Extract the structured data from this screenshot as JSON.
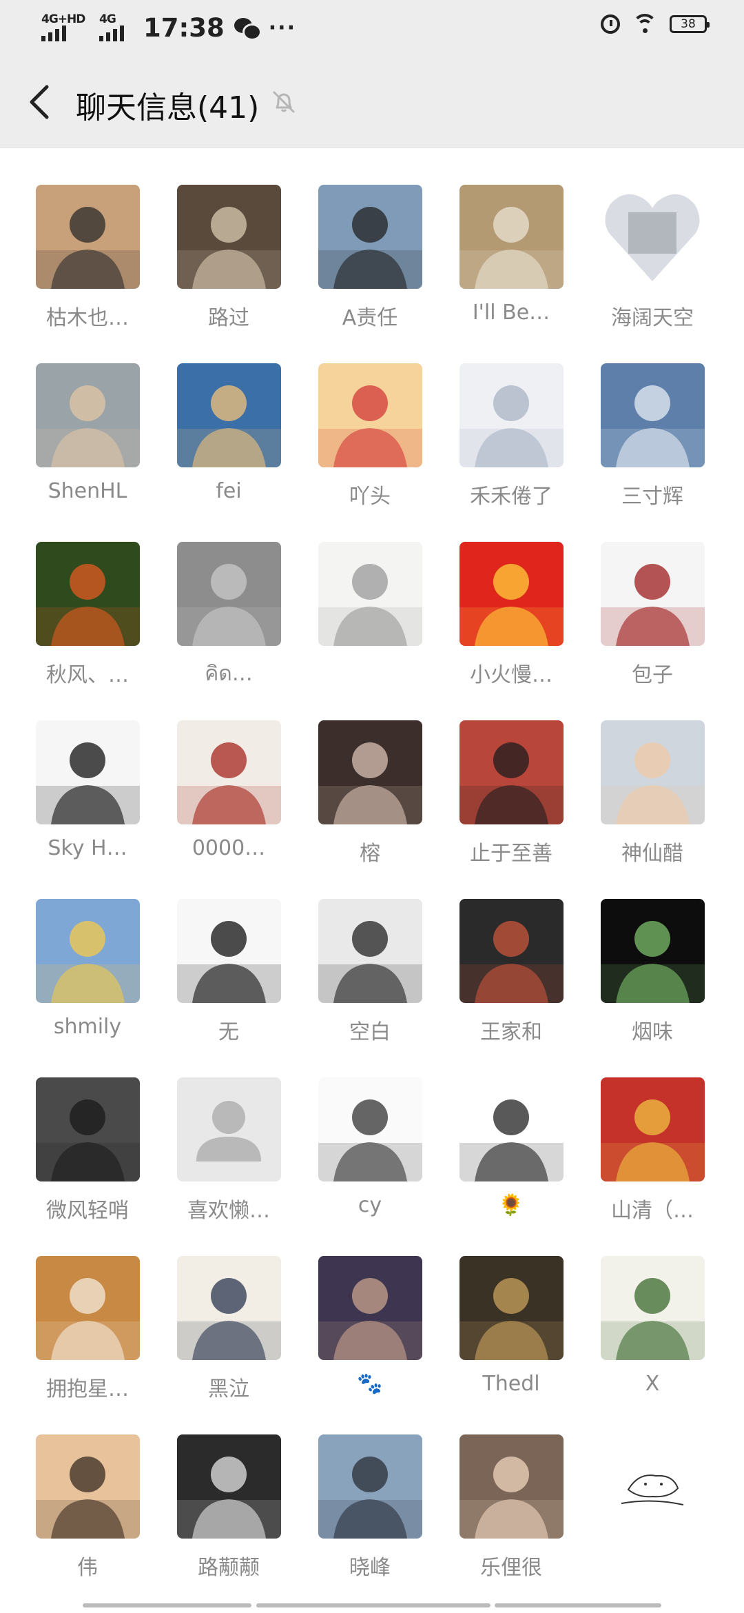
{
  "status_bar": {
    "signal1": "4G+HD",
    "signal2": "4G",
    "time": "17:38",
    "more": "···",
    "battery": "38"
  },
  "header": {
    "title": "聊天信息(41)",
    "icons": [
      "back-arrow-icon",
      "mute-bell-icon"
    ]
  },
  "members": [
    {
      "name": "枯木也…",
      "avatar": {
        "bg": "#c8a07a",
        "fg": "#2b2b2b",
        "kind": "photo"
      }
    },
    {
      "name": "路过",
      "avatar": {
        "bg": "#5a4a3c",
        "fg": "#d8c9b0",
        "kind": "photo"
      }
    },
    {
      "name": "A责任",
      "avatar": {
        "bg": "#7f9bb8",
        "fg": "#222222",
        "kind": "photo"
      }
    },
    {
      "name": "I'll Be…",
      "avatar": {
        "bg": "#b49a73",
        "fg": "#e9e2d3",
        "kind": "photo"
      }
    },
    {
      "name": "海阔天空",
      "avatar": {
        "bg": "#d9dde3",
        "fg": "#6b6f76",
        "kind": "heart"
      }
    },
    {
      "name": "ShenHL",
      "avatar": {
        "bg": "#9aa3a8",
        "fg": "#e0c6a6",
        "kind": "photo"
      }
    },
    {
      "name": "fei",
      "avatar": {
        "bg": "#3a6fa8",
        "fg": "#f3c27a",
        "kind": "photo"
      }
    },
    {
      "name": "吖头",
      "avatar": {
        "bg": "#f6d39a",
        "fg": "#d33a3a",
        "kind": "photo"
      }
    },
    {
      "name": "禾禾倦了",
      "avatar": {
        "bg": "#eef0f4",
        "fg": "#a9b4c4",
        "kind": "photo"
      }
    },
    {
      "name": "三寸辉",
      "avatar": {
        "bg": "#5d7fa9",
        "fg": "#e6ecf4",
        "kind": "photo"
      }
    },
    {
      "name": "秋风、…",
      "avatar": {
        "bg": "#2f4a1d",
        "fg": "#e35b22",
        "kind": "photo"
      }
    },
    {
      "name": "คิด…",
      "avatar": {
        "bg": "#8d8d8d",
        "fg": "#c9c9c9",
        "kind": "photo"
      }
    },
    {
      "name": "",
      "avatar": {
        "bg": "#f4f4f2",
        "fg": "#9a9a9a",
        "kind": "photo"
      }
    },
    {
      "name": "小火慢…",
      "avatar": {
        "bg": "#e0251d",
        "fg": "#ffcf3a",
        "kind": "photo"
      }
    },
    {
      "name": "包子",
      "avatar": {
        "bg": "#f5f5f5",
        "fg": "#9e1c1c",
        "kind": "photo"
      }
    },
    {
      "name": "Sky H…",
      "avatar": {
        "bg": "#f6f6f6",
        "fg": "#111111",
        "kind": "photo"
      }
    },
    {
      "name": "0000…",
      "avatar": {
        "bg": "#f1ece6",
        "fg": "#a4271d",
        "kind": "photo"
      }
    },
    {
      "name": "榕",
      "avatar": {
        "bg": "#3c2e2a",
        "fg": "#d9c2b4",
        "kind": "photo"
      }
    },
    {
      "name": "止于至善",
      "avatar": {
        "bg": "#b8463a",
        "fg": "#1e1e1e",
        "kind": "photo"
      }
    },
    {
      "name": "神仙醋",
      "avatar": {
        "bg": "#cfd6dd",
        "fg": "#f0c9a6",
        "kind": "photo"
      }
    },
    {
      "name": "shmily",
      "avatar": {
        "bg": "#7fa7d6",
        "fg": "#f4c94a",
        "kind": "photo"
      }
    },
    {
      "name": "无",
      "avatar": {
        "bg": "#f7f7f7",
        "fg": "#111111",
        "kind": "photo"
      }
    },
    {
      "name": "空白",
      "avatar": {
        "bg": "#e9e9e9",
        "fg": "#222222",
        "kind": "photo"
      }
    },
    {
      "name": "王家和",
      "avatar": {
        "bg": "#2a2a2a",
        "fg": "#c9553b",
        "kind": "photo"
      }
    },
    {
      "name": "烟味",
      "avatar": {
        "bg": "#0d0d0d",
        "fg": "#7bbf6a",
        "kind": "photo"
      }
    },
    {
      "name": "微风轻哨",
      "avatar": {
        "bg": "#4a4a4a",
        "fg": "#1a1a1a",
        "kind": "photo"
      }
    },
    {
      "name": "喜欢懒…",
      "avatar": {
        "bg": "#e8e8e8",
        "fg": "#b9b9b9",
        "kind": "default"
      }
    },
    {
      "name": "cy",
      "avatar": {
        "bg": "#fafafa",
        "fg": "#333333",
        "kind": "photo"
      }
    },
    {
      "name": "🌻",
      "avatar": {
        "bg": "#ffffff",
        "fg": "#222222",
        "kind": "photo"
      }
    },
    {
      "name": "山清（…",
      "avatar": {
        "bg": "#c4322a",
        "fg": "#f0c040",
        "kind": "photo"
      }
    },
    {
      "name": "拥抱星…",
      "avatar": {
        "bg": "#c88945",
        "fg": "#f3ead9",
        "kind": "photo"
      }
    },
    {
      "name": "黑泣",
      "avatar": {
        "bg": "#f2ede5",
        "fg": "#2b3550",
        "kind": "photo"
      }
    },
    {
      "name": "🐾",
      "avatar": {
        "bg": "#3e3650",
        "fg": "#c9a38c",
        "kind": "photo"
      }
    },
    {
      "name": "Thedl",
      "avatar": {
        "bg": "#3b3226",
        "fg": "#caa25c",
        "kind": "photo"
      }
    },
    {
      "name": "X",
      "avatar": {
        "bg": "#f2f1ea",
        "fg": "#3b6a2e",
        "kind": "photo"
      }
    },
    {
      "name": "伟",
      "avatar": {
        "bg": "#e7c29a",
        "fg": "#3a2b22",
        "kind": "photo"
      }
    },
    {
      "name": "路颟颟",
      "avatar": {
        "bg": "#2b2b2b",
        "fg": "#e4e4e4",
        "kind": "photo"
      }
    },
    {
      "name": "晓峰",
      "avatar": {
        "bg": "#8aa3bd",
        "fg": "#2a2f38",
        "kind": "photo"
      }
    },
    {
      "name": "乐俚很",
      "avatar": {
        "bg": "#7a6556",
        "fg": "#f0d6bf",
        "kind": "photo"
      }
    },
    {
      "name": "",
      "avatar": {
        "bg": "#ffffff",
        "fg": "#333333",
        "kind": "sketch"
      }
    }
  ]
}
